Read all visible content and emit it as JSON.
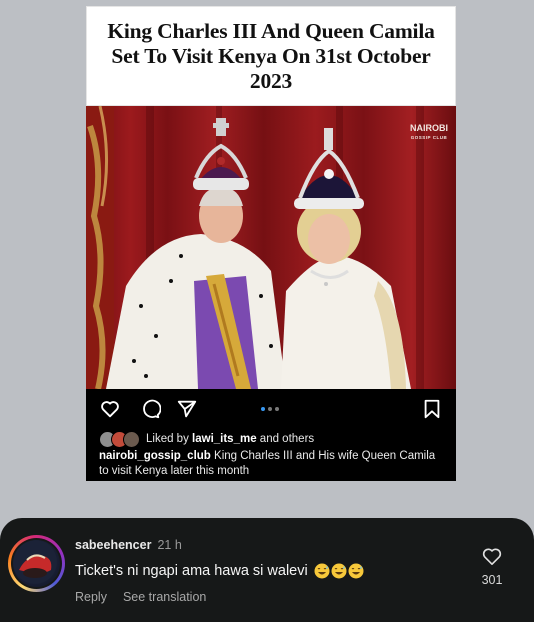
{
  "post": {
    "headline": "King Charles III And Queen Camila Set To Visit Kenya On 31st October 2023",
    "watermark_top": "NAIROBI",
    "watermark_bottom": "GOSSIP CLUB",
    "likes": {
      "prefix": "Liked by ",
      "user": "lawi_its_me",
      "suffix": " and others"
    },
    "caption": {
      "author": "nairobi_gossip_club",
      "text": " King Charles III and His wife Queen Camila to visit Kenya later this month"
    },
    "carousel": {
      "total": 3,
      "active": 1
    },
    "icons": [
      "heart-icon",
      "comment-icon",
      "share-icon",
      "bookmark-icon"
    ]
  },
  "comment": {
    "username": "sabeehencer",
    "time": "21 h",
    "text": "Ticket's ni ngapi ama hawa si walevi",
    "emojis": [
      "😅",
      "😅",
      "😅"
    ],
    "reply_label": "Reply",
    "translate_label": "See translation",
    "like_count": "301"
  },
  "colors": {
    "background": "#bcbfc4",
    "sheet": "#161818",
    "carousel_active": "#3797f0"
  }
}
